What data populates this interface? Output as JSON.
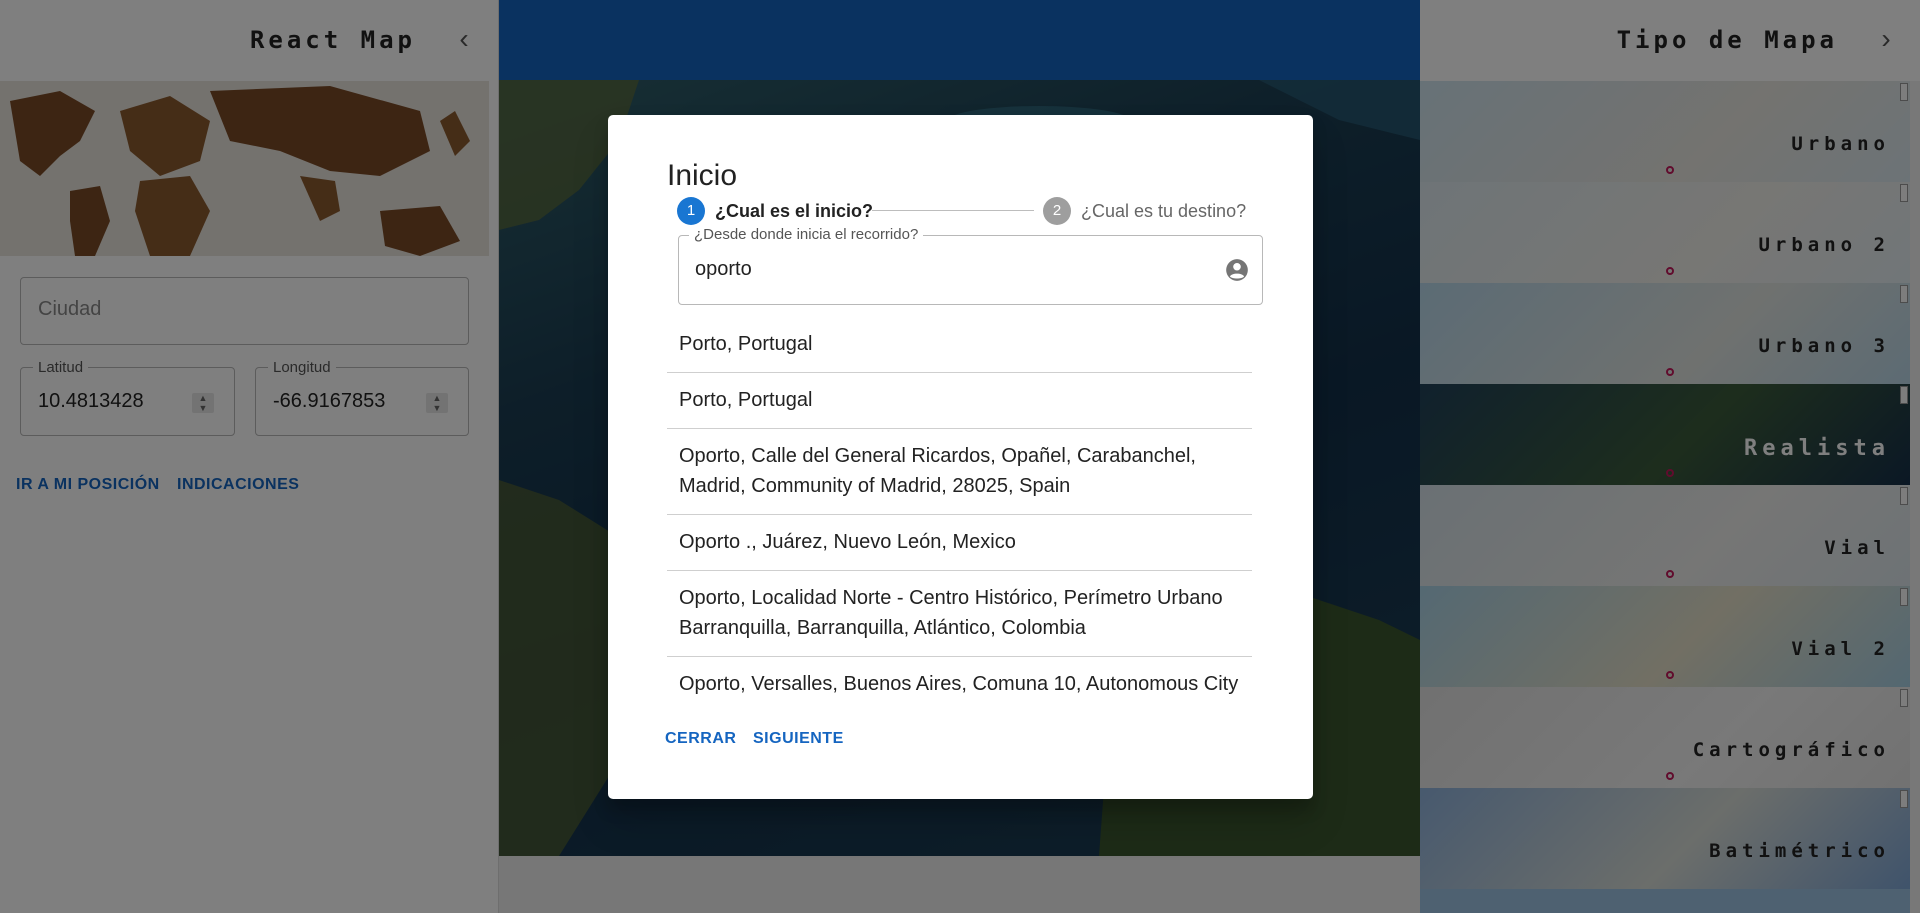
{
  "left_panel": {
    "title": "React Map",
    "city": {
      "placeholder": "Ciudad"
    },
    "latitude": {
      "label": "Latitud",
      "value": "10.4813428"
    },
    "longitude": {
      "label": "Longitud",
      "value": "-66.9167853"
    },
    "buttons": {
      "my_position": "IR A MI POSICIÓN",
      "directions": "INDICACIONES"
    }
  },
  "right_panel": {
    "title": "Tipo de Mapa",
    "tiles": [
      {
        "name": "Urbano"
      },
      {
        "name": "Urbano 2"
      },
      {
        "name": "Urbano 3"
      },
      {
        "name": "Realista"
      },
      {
        "name": "Vial"
      },
      {
        "name": "Vial 2"
      },
      {
        "name": "Cartográfico"
      },
      {
        "name": "Batimétrico"
      }
    ]
  },
  "dialog": {
    "title": "Inicio",
    "steps": [
      {
        "number": "1",
        "label": "¿Cual es el inicio?",
        "active": true
      },
      {
        "number": "2",
        "label": "¿Cual es tu destino?",
        "active": false
      }
    ],
    "origin_field": {
      "label": "¿Desde donde inicia el recorrido?",
      "value": "oporto"
    },
    "suggestions": [
      "Porto, Portugal",
      "Porto, Portugal",
      "Oporto, Calle del General Ricardos, Opañel, Carabanchel, Madrid, Community of Madrid, 28025, Spain",
      "Oporto ., Juárez, Nuevo León, Mexico",
      "Oporto, Localidad Norte - Centro Histórico, Perímetro Urbano Barranquilla, Barranquilla, Atlántico, Colombia",
      "Oporto, Versalles, Buenos Aires, Comuna 10, Autonomous City"
    ],
    "buttons": {
      "close": "CERRAR",
      "next": "SIGUIENTE"
    }
  },
  "colors": {
    "primary": "#1565c0",
    "step_active": "#1976d2",
    "step_inactive": "#9e9e9e"
  }
}
